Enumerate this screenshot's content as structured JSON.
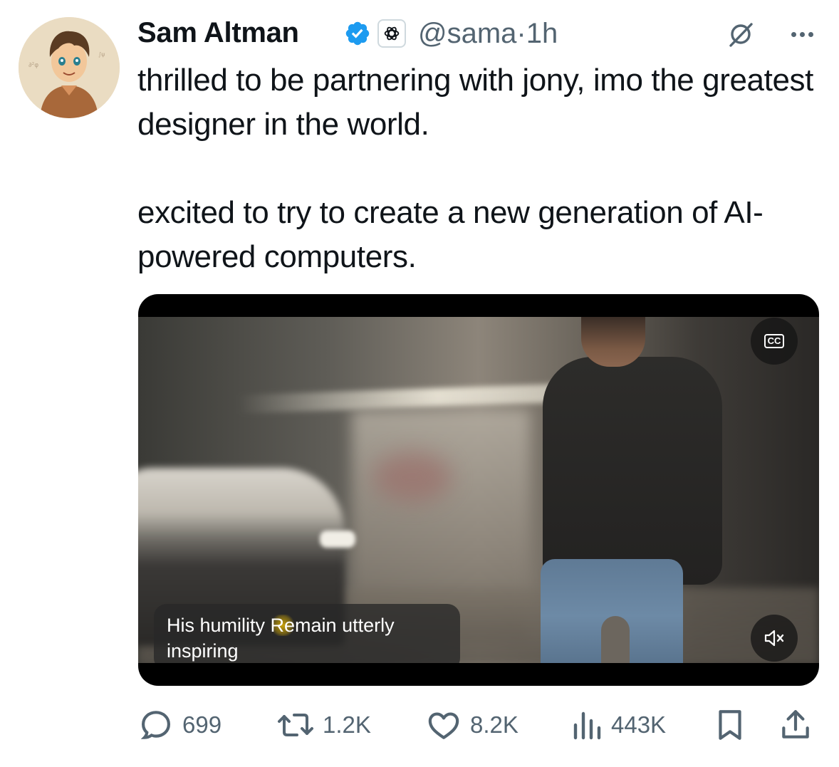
{
  "author": {
    "name": "Sam Altman",
    "handle": "@sama",
    "separator": "·",
    "time": "1h"
  },
  "post": {
    "paragraphs": [
      "thrilled to be partnering with jony, imo the greatest designer in the world.",
      "excited to try to create a new generation of AI-powered computers."
    ]
  },
  "video": {
    "caption_plain": "His humility ",
    "caption_highlight": "Re",
    "caption_rest": "main utterly",
    "caption_line2": "inspiring",
    "cc_label": "CC"
  },
  "actions": {
    "replies": "699",
    "reposts": "1.2K",
    "likes": "8.2K",
    "views": "443K"
  },
  "colors": {
    "text": "#0f1419",
    "secondary": "#536471",
    "verified": "#1d9bf0",
    "caption_highlight": "#e6b800"
  },
  "icons": [
    "verified-badge-icon",
    "openai-affiliation-icon",
    "grok-icon",
    "more-icon",
    "cc-icon",
    "mute-icon",
    "reply-icon",
    "repost-icon",
    "like-icon",
    "views-icon",
    "bookmark-icon",
    "share-icon"
  ]
}
